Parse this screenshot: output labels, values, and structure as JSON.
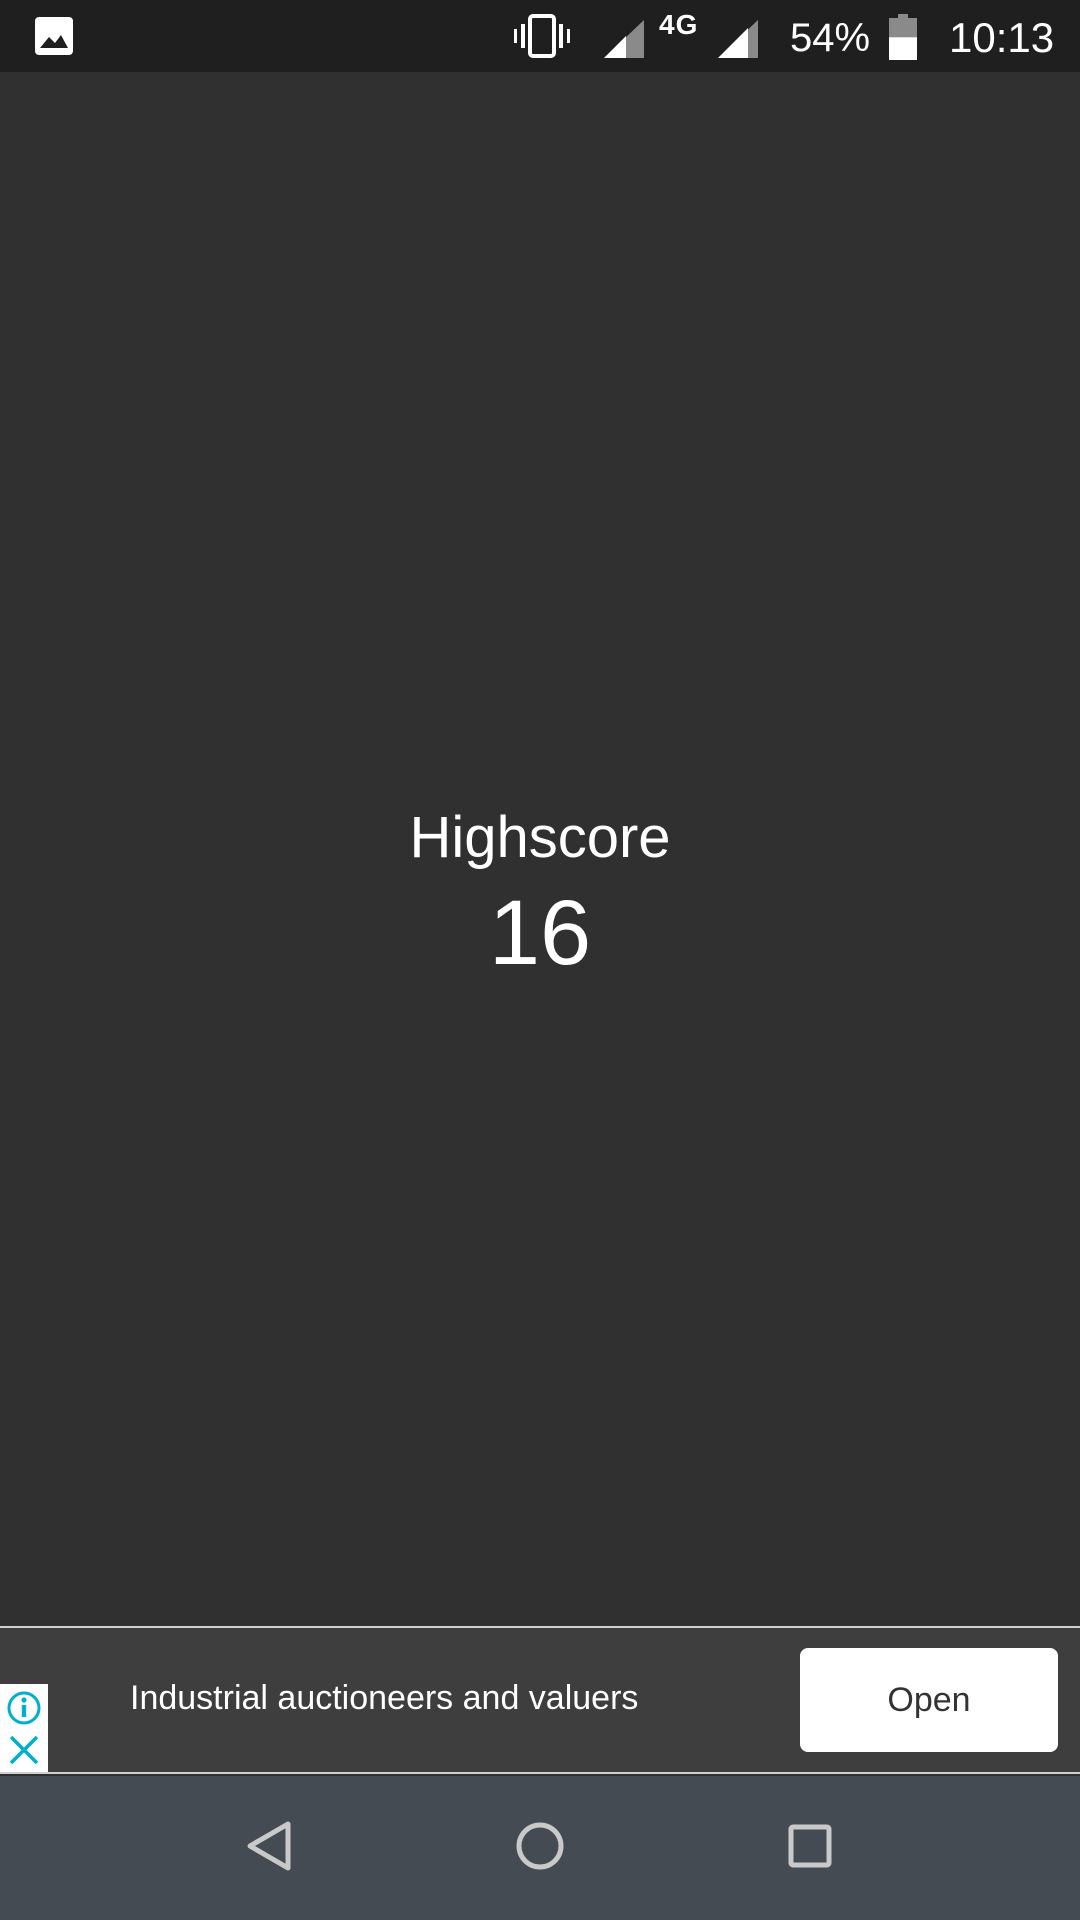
{
  "status_bar": {
    "notification_icon": "gallery-icon",
    "network_type": "4G",
    "battery_percent": "54%",
    "battery_level": 0.54,
    "time": "10:13"
  },
  "main": {
    "highscore_label": "Highscore",
    "highscore_value": "16"
  },
  "ad": {
    "text": "Industrial auctioneers and valuers",
    "button_label": "Open",
    "icons": [
      "info-icon",
      "close-icon"
    ],
    "accent_color": "#00aecd"
  },
  "nav_bar": {
    "buttons": [
      "back-icon",
      "home-icon",
      "recents-icon"
    ]
  },
  "colors": {
    "background": "#303030",
    "status_bar": "#1f1f1f",
    "nav_bar": "#454b52",
    "ad_background": "#3e3e3e"
  }
}
